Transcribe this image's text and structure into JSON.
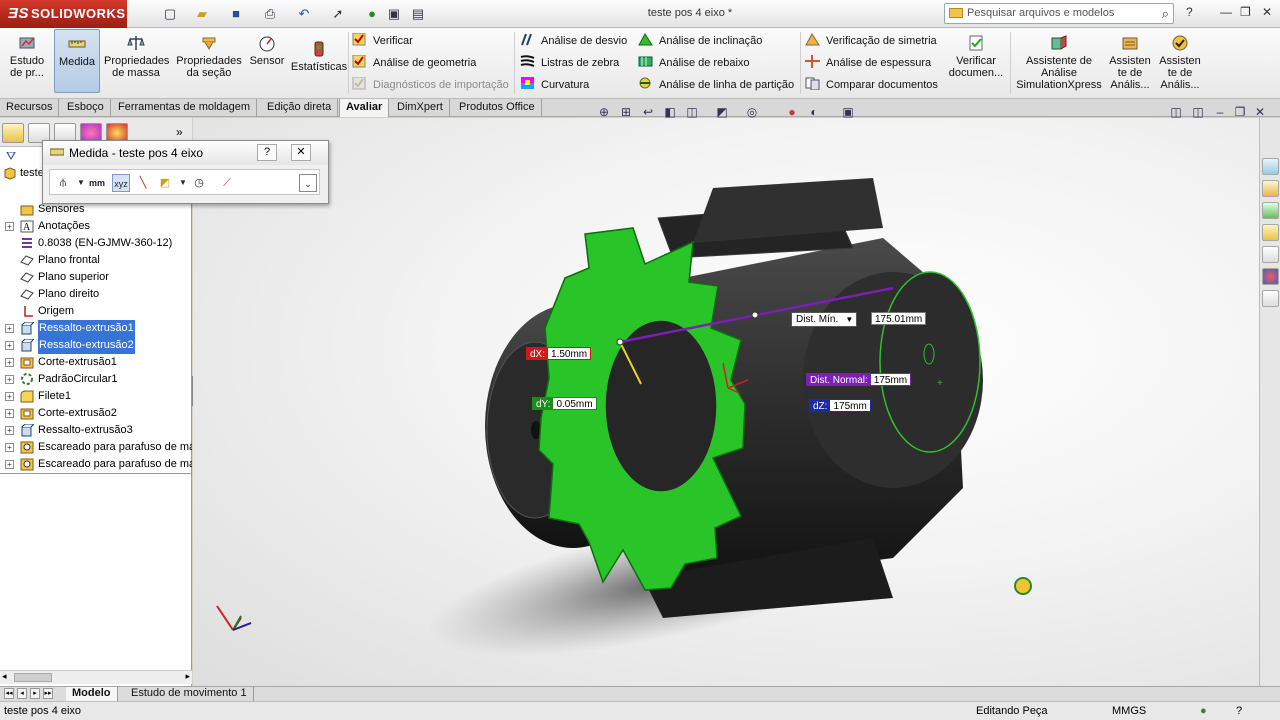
{
  "app": {
    "logo": "SOLIDWORKS",
    "doc_title": "teste pos 4 eixo *"
  },
  "search": {
    "placeholder": "Pesquisar arquivos e modelos"
  },
  "ribbon": {
    "large": [
      {
        "label": "Estudo de pr..."
      },
      {
        "label": "Medida"
      },
      {
        "label": "Propriedades de massa"
      },
      {
        "label": "Propriedades da seção"
      },
      {
        "label": "Sensor"
      },
      {
        "label": "Estatísticas"
      }
    ],
    "col1": [
      "Verificar",
      "Análise de geometria",
      "Diagnósticos de importação"
    ],
    "col2": [
      "Análise de desvio",
      "Listras de zebra",
      "Curvatura"
    ],
    "col3": [
      "Análise de inclinação",
      "Análise de rebaixo",
      "Análise de linha de partição"
    ],
    "col4": [
      "Verificação de simetria",
      "Análise de espessura",
      "Comparar documentos"
    ],
    "large2": [
      {
        "label": "Verificar documen..."
      },
      {
        "label": "Assistente de Análise SimulationXpress"
      },
      {
        "label": "Assisten te de Anális..."
      },
      {
        "label": "Assisten te de Anális..."
      }
    ]
  },
  "tabs": [
    "Recursos",
    "Esboço",
    "Ferramentas de moldagem",
    "Edição direta",
    "Avaliar",
    "DimXpert",
    "Produtos Office"
  ],
  "tree": {
    "root": "teste",
    "items": [
      {
        "label": "Sensores"
      },
      {
        "label": "Anotações"
      },
      {
        "label": "0.8038 (EN-GJMW-360-12)"
      },
      {
        "label": "Plano frontal"
      },
      {
        "label": "Plano superior"
      },
      {
        "label": "Plano direito"
      },
      {
        "label": "Origem"
      },
      {
        "label": "Ressalto-extrusão1"
      },
      {
        "label": "Ressalto-extrusão2"
      },
      {
        "label": "Corte-extrusão1"
      },
      {
        "label": "PadrãoCircular1"
      },
      {
        "label": "Filete1"
      },
      {
        "label": "Corte-extrusão2"
      },
      {
        "label": "Ressalto-extrusão3"
      },
      {
        "label": "Escareado para parafuso de ma"
      },
      {
        "label": "Escareado para parafuso de ma"
      }
    ]
  },
  "measure": {
    "title": "Medida - teste pos 4 eixo",
    "help": "?",
    "close": "✕"
  },
  "callouts": {
    "dist_min_label": "Dist. Mín.",
    "dist_min_value": "175.01mm",
    "dx_label": "dX:",
    "dx_value": "1.50mm",
    "dy_label": "dY:",
    "dy_value": "0.05mm",
    "dist_normal_label": "Dist. Normal:",
    "dist_normal_value": "175mm",
    "dz_label": "dZ:",
    "dz_value": "175mm"
  },
  "bottom_tabs": [
    "Modelo",
    "Estudo de movimento 1"
  ],
  "status": {
    "doc": "teste pos 4 eixo",
    "mode": "Editando Peça",
    "units": "MMGS"
  },
  "colors": {
    "accent": "#3874d8",
    "highlight": "#22b822",
    "dx": "#d01818",
    "dy": "#1f8a1f",
    "dnormal": "#7a1fb8",
    "dz": "#1b2aa8"
  }
}
